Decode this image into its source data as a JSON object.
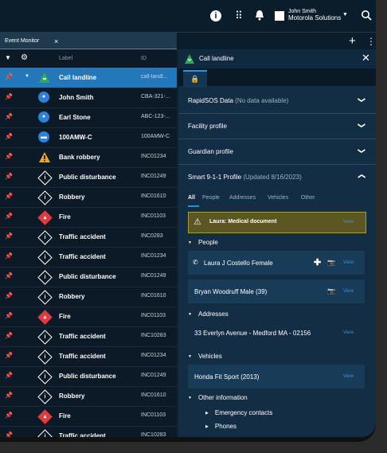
{
  "topbar": {
    "user_name": "John Smith",
    "org": "Motorola Solutions"
  },
  "tabs": {
    "active": "Event Monitor",
    "close": "×",
    "add": "+",
    "more": "⋮"
  },
  "list": {
    "columns": {
      "label": "Label",
      "id": "ID"
    },
    "rows": [
      {
        "label": "Call landline",
        "id": "call-landl...",
        "icon": "phone-triangle-icon",
        "selected": true
      },
      {
        "label": "John Smith",
        "id": "CBA-321-...",
        "icon": "person-circle-icon"
      },
      {
        "label": "Earl Stone",
        "id": "ABC-123-...",
        "icon": "person-circle-icon"
      },
      {
        "label": "100AMW-C",
        "id": "100AMW-C",
        "icon": "vehicle-circle-icon"
      },
      {
        "label": "Bank robbery",
        "id": "INC01234",
        "icon": "warning-triangle-icon"
      },
      {
        "label": "Public disturbance",
        "id": "INC01249",
        "icon": "incident-diamond-icon"
      },
      {
        "label": "Robbery",
        "id": "INC01610",
        "icon": "incident-diamond-icon"
      },
      {
        "label": "Fire",
        "id": "INC01103",
        "icon": "fire-diamond-icon"
      },
      {
        "label": "Traffic accident",
        "id": "INC0283",
        "icon": "incident-diamond-icon"
      },
      {
        "label": "Traffic accident",
        "id": "INC01234",
        "icon": "incident-diamond-icon"
      },
      {
        "label": "Public disturbance",
        "id": "INC01249",
        "icon": "incident-diamond-icon"
      },
      {
        "label": "Robbery",
        "id": "INC01610",
        "icon": "incident-diamond-icon"
      },
      {
        "label": "Fire",
        "id": "INC01103",
        "icon": "fire-diamond-icon"
      },
      {
        "label": "Traffic accident",
        "id": "INC10283",
        "icon": "incident-diamond-icon"
      },
      {
        "label": "Traffic accident",
        "id": "INC01234",
        "icon": "incident-diamond-icon"
      },
      {
        "label": "Public disturbance",
        "id": "INC01249",
        "icon": "incident-diamond-icon"
      },
      {
        "label": "Robbery",
        "id": "INC01610",
        "icon": "incident-diamond-icon"
      },
      {
        "label": "Fire",
        "id": "INC01103",
        "icon": "fire-diamond-icon"
      },
      {
        "label": "Traffic accident",
        "id": "INC10283",
        "icon": "incident-diamond-icon"
      }
    ]
  },
  "panel": {
    "title": "Call landline",
    "close": "✕",
    "rapidsos_title": "RapidSOS Data",
    "rapidsos_note": "(No data available)",
    "facility_title": "Facility profile",
    "guardian_title": "Guardian profile",
    "smart911_title": "Smart 9-1-1 Profile",
    "smart911_updated": "(Updated 8/16/2023)",
    "subtabs": [
      "All",
      "People",
      "Addresses",
      "Vehicles",
      "Other"
    ],
    "alert": {
      "text": "Laura: Medical document",
      "action": "View"
    },
    "people_header": "People",
    "person1": {
      "text": "Laura J Costello  Female",
      "action": "View"
    },
    "person2": {
      "text": "Bryan Woodruff  Male (39)",
      "action": "View"
    },
    "addresses_header": "Addresses",
    "address1": {
      "text": "33 Everlyn Avenue - Medford MA - 02156",
      "action": "View"
    },
    "vehicles_header": "Vehicles",
    "vehicle1": {
      "text": "Honda Fit Sport (2013)",
      "action": "View"
    },
    "other_header": "Other information",
    "emergency_contacts": "Emergency contacts",
    "phones": "Phones"
  },
  "colors": {
    "accent": "#2478b9",
    "alert_bg": "#5c5722",
    "link": "#3d8fd1",
    "fire": "#e0393e"
  }
}
